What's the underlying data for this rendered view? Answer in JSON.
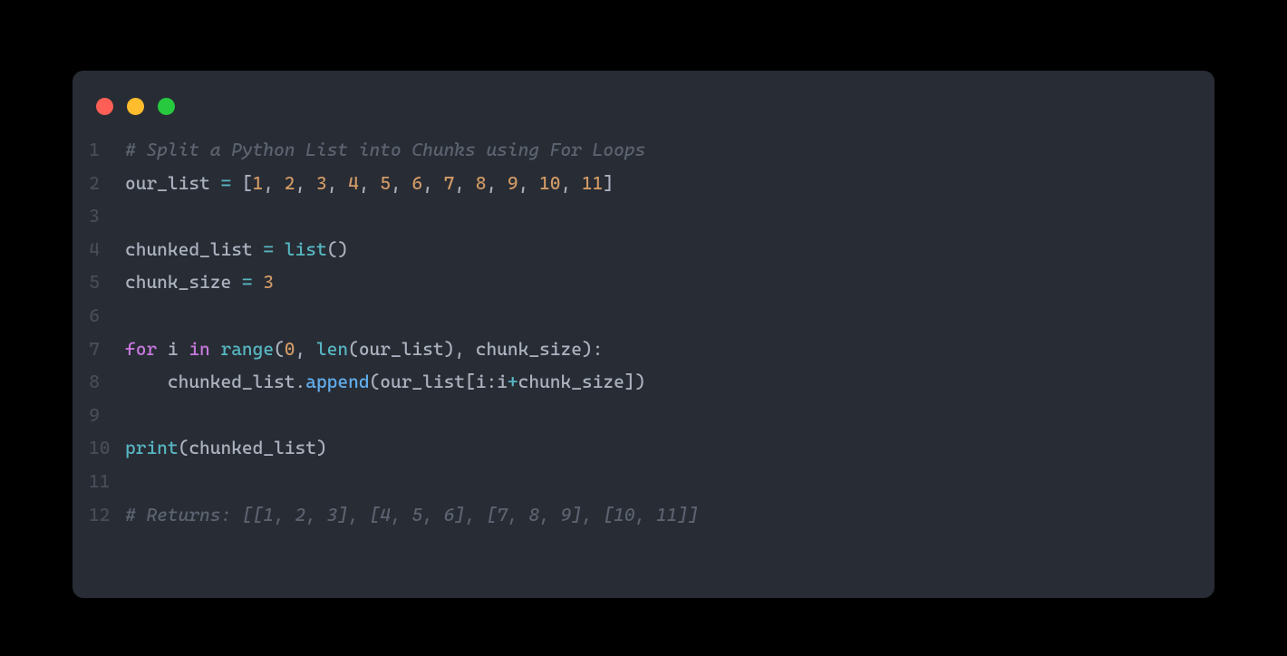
{
  "window": {
    "dots": [
      "red",
      "yellow",
      "green"
    ]
  },
  "code": {
    "lines": [
      {
        "n": "1",
        "tokens": [
          {
            "c": "cmt",
            "t": "# Split a Python List into Chunks using For Loops"
          }
        ]
      },
      {
        "n": "2",
        "tokens": [
          {
            "c": "txt",
            "t": "our_list "
          },
          {
            "c": "op",
            "t": "="
          },
          {
            "c": "txt",
            "t": " ["
          },
          {
            "c": "num",
            "t": "1"
          },
          {
            "c": "txt",
            "t": ", "
          },
          {
            "c": "num",
            "t": "2"
          },
          {
            "c": "txt",
            "t": ", "
          },
          {
            "c": "num",
            "t": "3"
          },
          {
            "c": "txt",
            "t": ", "
          },
          {
            "c": "num",
            "t": "4"
          },
          {
            "c": "txt",
            "t": ", "
          },
          {
            "c": "num",
            "t": "5"
          },
          {
            "c": "txt",
            "t": ", "
          },
          {
            "c": "num",
            "t": "6"
          },
          {
            "c": "txt",
            "t": ", "
          },
          {
            "c": "num",
            "t": "7"
          },
          {
            "c": "txt",
            "t": ", "
          },
          {
            "c": "num",
            "t": "8"
          },
          {
            "c": "txt",
            "t": ", "
          },
          {
            "c": "num",
            "t": "9"
          },
          {
            "c": "txt",
            "t": ", "
          },
          {
            "c": "num",
            "t": "10"
          },
          {
            "c": "txt",
            "t": ", "
          },
          {
            "c": "num",
            "t": "11"
          },
          {
            "c": "txt",
            "t": "]"
          }
        ]
      },
      {
        "n": "3",
        "tokens": []
      },
      {
        "n": "4",
        "tokens": [
          {
            "c": "txt",
            "t": "chunked_list "
          },
          {
            "c": "op",
            "t": "="
          },
          {
            "c": "txt",
            "t": " "
          },
          {
            "c": "bi",
            "t": "list"
          },
          {
            "c": "txt",
            "t": "()"
          }
        ]
      },
      {
        "n": "5",
        "tokens": [
          {
            "c": "txt",
            "t": "chunk_size "
          },
          {
            "c": "op",
            "t": "="
          },
          {
            "c": "txt",
            "t": " "
          },
          {
            "c": "num",
            "t": "3"
          }
        ]
      },
      {
        "n": "6",
        "tokens": []
      },
      {
        "n": "7",
        "tokens": [
          {
            "c": "kw",
            "t": "for"
          },
          {
            "c": "txt",
            "t": " i "
          },
          {
            "c": "kw",
            "t": "in"
          },
          {
            "c": "txt",
            "t": " "
          },
          {
            "c": "bi",
            "t": "range"
          },
          {
            "c": "txt",
            "t": "("
          },
          {
            "c": "num",
            "t": "0"
          },
          {
            "c": "txt",
            "t": ", "
          },
          {
            "c": "bi",
            "t": "len"
          },
          {
            "c": "txt",
            "t": "(our_list), chunk_size):"
          }
        ]
      },
      {
        "n": "8",
        "tokens": [
          {
            "c": "txt",
            "t": "    chunked_list."
          },
          {
            "c": "fn",
            "t": "append"
          },
          {
            "c": "txt",
            "t": "(our_list[i:i"
          },
          {
            "c": "op",
            "t": "+"
          },
          {
            "c": "txt",
            "t": "chunk_size])"
          }
        ]
      },
      {
        "n": "9",
        "tokens": []
      },
      {
        "n": "10",
        "tokens": [
          {
            "c": "bi",
            "t": "print"
          },
          {
            "c": "txt",
            "t": "(chunked_list)"
          }
        ]
      },
      {
        "n": "11",
        "tokens": []
      },
      {
        "n": "12",
        "tokens": [
          {
            "c": "cmt",
            "t": "# Returns: [[1, 2, 3], [4, 5, 6], [7, 8, 9], [10, 11]]"
          }
        ]
      }
    ]
  }
}
